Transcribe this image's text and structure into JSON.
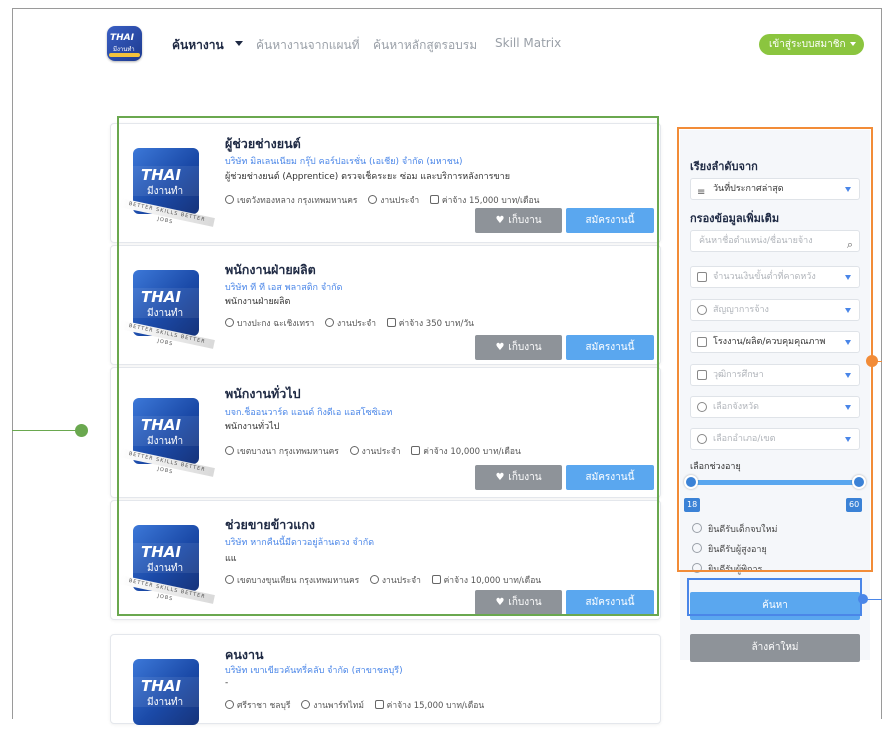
{
  "header": {
    "logo_text": "THAI",
    "logo_sub": "มีงานทำ",
    "nav": [
      "ค้นหางาน",
      "ค้นหางานจากแผนที่",
      "ค้นหาหลักสูตรอบรม",
      "Skill Matrix"
    ],
    "login_label": "เข้าสู่ระบบสมาชิก"
  },
  "thumb": {
    "brand": "THAI",
    "sub": "มีงานทำ",
    "band": "BETTER SKILLS BETTER JOBS"
  },
  "jobs": [
    {
      "title": "ผู้ช่วยช่างยนต์",
      "company": "บริษัท มิลเลนเนียม กรุ๊ป คอร์ปอเรชั่น (เอเชีย) จำกัด (มหาชน)",
      "desc": "ผู้ช่วยช่างยนต์ (Apprentice) ตรวจเช็คระยะ ซ่อม และบริการหลังการขาย",
      "location": "เขตวังทองหลาง กรุงเทพมหานคร",
      "type": "งานประจำ",
      "wage": "ค่าจ้าง 15,000 บาท/เดือน"
    },
    {
      "title": "พนักงานฝ่ายผลิต",
      "company": "บริษัท ที ที เอส พลาสติก จำกัด",
      "desc": "พนักงานฝ่ายผลิต",
      "location": "บางปะกง ฉะเชิงเทรา",
      "type": "งานประจำ",
      "wage": "ค่าจ้าง 350 บาท/วัน"
    },
    {
      "title": "พนักงานทั่วไป",
      "company": "บจก.ช็ออนวาร์ด แอนด์ กิงดีเอ แอสโซซิเอท",
      "desc": "พนักงานทั่วไป",
      "location": "เขตบางนา กรุงเทพมหานคร",
      "type": "งานประจำ",
      "wage": "ค่าจ้าง 10,000 บาท/เดือน"
    },
    {
      "title": "ช่วยขายข้าวแกง",
      "company": "บริษัท หากคืนนี้มีดาวอยู่ล้านดวง จำกัด",
      "desc": "แแ",
      "location": "เขตบางขุนเทียน กรุงเทพมหานคร",
      "type": "งานประจำ",
      "wage": "ค่าจ้าง 10,000 บาท/เดือน"
    },
    {
      "title": "คนงาน",
      "company": "บริษัท เขาเขียวคันทรี่คลับ จำกัด (สาขาชลบุรี)",
      "desc": "-",
      "location": "ศรีราชา ชลบุรี",
      "type": "งานพาร์ทไทม์",
      "wage": "ค่าจ้าง 15,000 บาท/เดือน"
    }
  ],
  "actions": {
    "save": "เก็บงาน",
    "apply": "สมัครงานนี้"
  },
  "sidebar": {
    "sort_heading": "เรียงลำดับจาก",
    "sort_value": "วันที่ประกาศล่าสุด",
    "filter_heading": "กรองข้อมูลเพิ่มเติม",
    "keyword_placeholder": "ค้นหาชื่อตำแหน่ง/ชื่อนายจ้าง",
    "salary_placeholder": "จำนวนเงินขั้นต่ำที่คาดหวัง",
    "contract_placeholder": "สัญญาการจ้าง",
    "category_value": "โรงงาน/ผลิต/ควบคุมคุณภาพ",
    "education_placeholder": "วุฒิการศึกษา",
    "province_placeholder": "เลือกจังหวัด",
    "district_placeholder": "เลือกอำเภอ/เขต",
    "age_label": "เลือกช่วงอายุ",
    "age_min": "18",
    "age_max": "60",
    "options": [
      "ยินดีรับเด็กจบใหม่",
      "ยินดีรับผู้สูงอายุ",
      "ยินดีรับผู้พิการ"
    ],
    "search_label": "ค้นหา",
    "reset_label": "ล้างค่าใหม่"
  },
  "colors": {
    "accent": "#5aa7ef",
    "green_annotation": "#6aa84f",
    "orange_annotation": "#f28c38",
    "blue_annotation": "#4a86e8",
    "login": "#8bc53f"
  }
}
